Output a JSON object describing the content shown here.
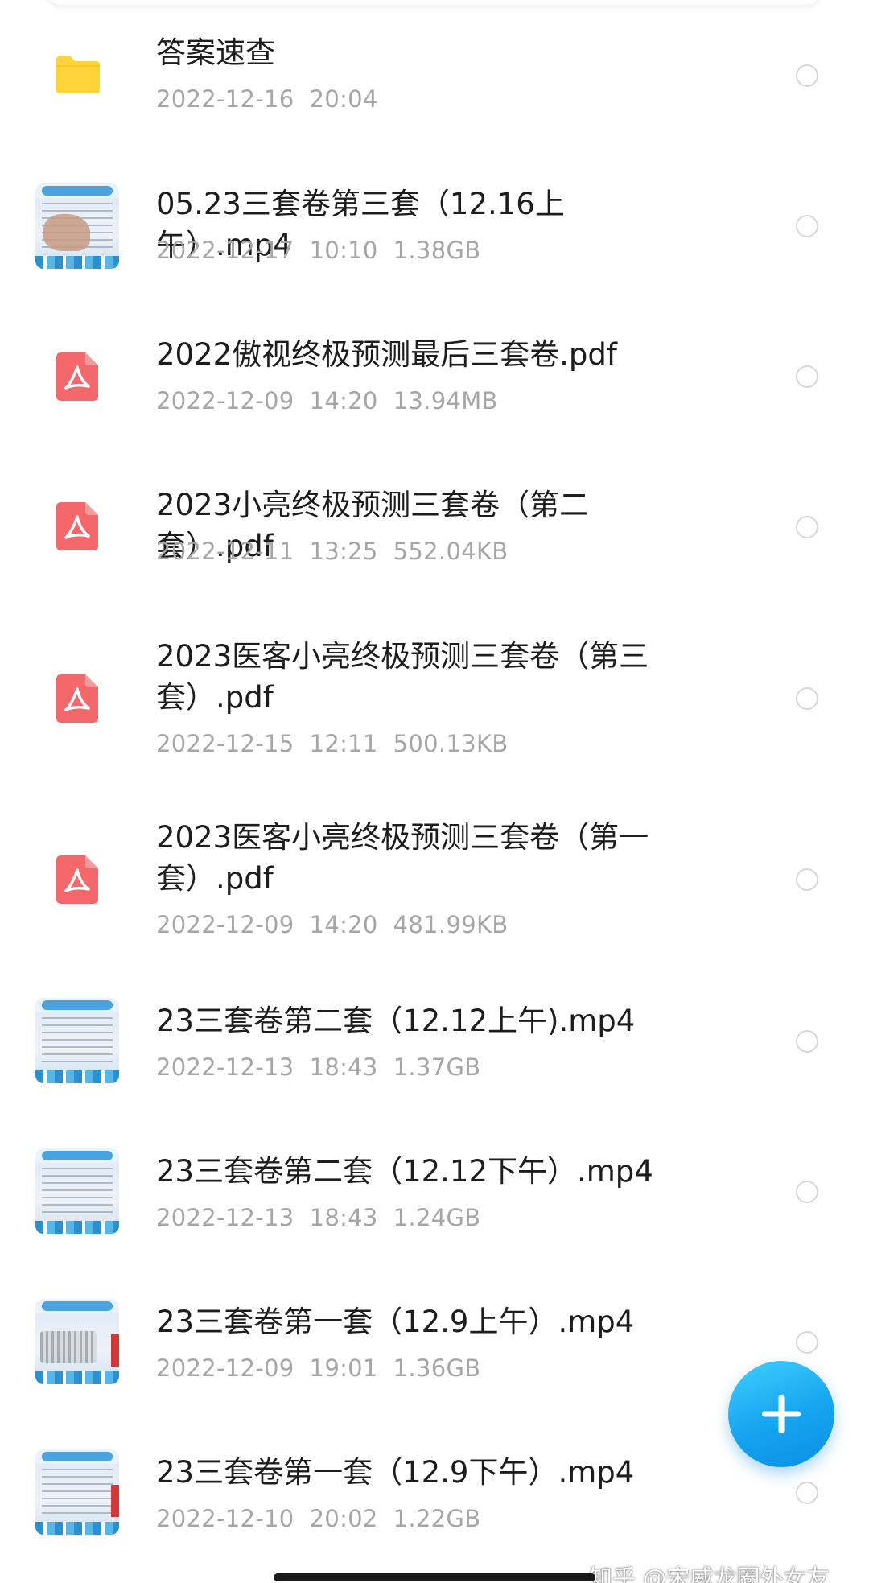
{
  "files": [
    {
      "type": "folder",
      "icon": "folder-icon",
      "name": "答案速查",
      "meta": "2022-12-16  20:04"
    },
    {
      "type": "video",
      "icon": "video-thumbnail",
      "name": "05.23三套卷第三套（12.16上午）.mp4",
      "meta": "2022-12-17  10:10  1.38GB"
    },
    {
      "type": "pdf",
      "icon": "pdf-icon",
      "name": "2022傲视终极预测最后三套卷.pdf",
      "meta": "2022-12-09  14:20  13.94MB"
    },
    {
      "type": "pdf",
      "icon": "pdf-icon",
      "name": "2023小亮终极预测三套卷（第二套）.pdf",
      "meta": "2022-12-11  13:25  552.04KB"
    },
    {
      "type": "pdf",
      "icon": "pdf-icon",
      "name": "2023医客小亮终极预测三套卷（第三套）.pdf",
      "meta": "2022-12-15  12:11  500.13KB"
    },
    {
      "type": "pdf",
      "icon": "pdf-icon",
      "name": "2023医客小亮终极预测三套卷（第一套）.pdf",
      "meta": "2022-12-09  14:20  481.99KB"
    },
    {
      "type": "video",
      "icon": "video-thumbnail",
      "name": "23三套卷第二套（12.12上午).mp4",
      "meta": "2022-12-13  18:43  1.37GB"
    },
    {
      "type": "video",
      "icon": "video-thumbnail",
      "name": "23三套卷第二套（12.12下午）.mp4",
      "meta": "2022-12-13  18:43  1.24GB"
    },
    {
      "type": "video",
      "icon": "video-thumbnail",
      "name": "23三套卷第一套（12.9上午）.mp4",
      "meta": "2022-12-09  19:01  1.36GB"
    },
    {
      "type": "video",
      "icon": "video-thumbnail",
      "name": "23三套卷第一套（12.9下午）.mp4",
      "meta": "2022-12-10  20:02  1.22GB"
    }
  ],
  "fab": {
    "icon": "plus-icon"
  },
  "watermark": "知乎 @宋威龙圈外女友",
  "colors": {
    "folder": "#ffd43b",
    "pdf": "#f4676a",
    "fab": "#15a4ef",
    "meta_text": "#a6a6a6",
    "name_text": "#1d1d1d"
  }
}
